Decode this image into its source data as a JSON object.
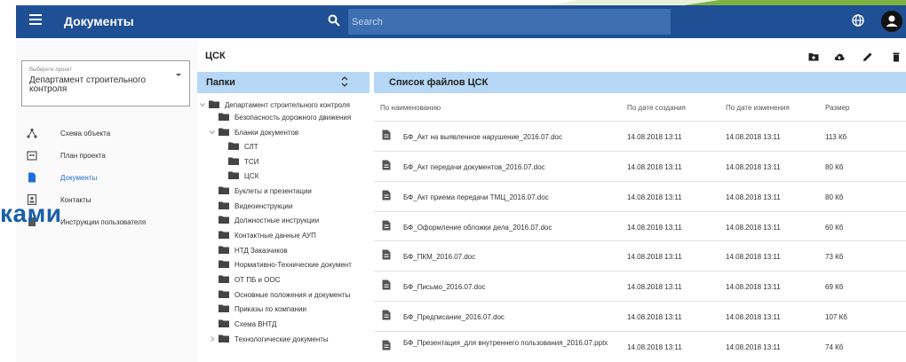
{
  "header": {
    "title": "Документы",
    "search_placeholder": "Search"
  },
  "project_select": {
    "caption": "Выберите проект",
    "value": "Департамент строительного контроля"
  },
  "nav": [
    {
      "label": "Схема объекта",
      "icon": "hierarchy-icon"
    },
    {
      "label": "План проекта",
      "icon": "calendar-icon"
    },
    {
      "label": "Документы",
      "icon": "document-icon",
      "active": true
    },
    {
      "label": "Контакты",
      "icon": "contacts-icon"
    },
    {
      "label": "Инструкции пользователя",
      "icon": "book-icon"
    }
  ],
  "overlay_text": "ками",
  "section_title": "ЦСК",
  "toolbar": [
    "new-folder-icon",
    "upload-cloud-icon",
    "edit-pencil-icon",
    "delete-trash-icon"
  ],
  "folders": {
    "title": "Папки",
    "items": [
      {
        "label": "Департамент строительного контроля",
        "level": 0,
        "chevron": "down"
      },
      {
        "label": "Безопасность дорожного движения",
        "level": 1
      },
      {
        "label": "Бланки документов",
        "level": 1,
        "chevron": "down"
      },
      {
        "label": "СЛТ",
        "level": 2
      },
      {
        "label": "ТСИ",
        "level": 2
      },
      {
        "label": "ЦСК",
        "level": 2
      },
      {
        "label": "Буклеты и презентации",
        "level": 1
      },
      {
        "label": "Видеоинструкции",
        "level": 1
      },
      {
        "label": "Должностные инструкции",
        "level": 1
      },
      {
        "label": "Контактные данные АУП",
        "level": 1
      },
      {
        "label": "НТД Заказчиков",
        "level": 1
      },
      {
        "label": "Нормативно-Технические документ",
        "level": 1
      },
      {
        "label": "ОТ ПБ и ООС",
        "level": 1
      },
      {
        "label": "Основные положения и документы",
        "level": 1
      },
      {
        "label": "Приказы по компании",
        "level": 1
      },
      {
        "label": "Схема ВНТД",
        "level": 1
      },
      {
        "label": "Технологические документы",
        "level": 1,
        "chevron": "right"
      }
    ]
  },
  "files": {
    "title": "Список файлов ЦСК",
    "columns": [
      "По наименованию",
      "По дате создания",
      "По дате изменения",
      "Размер"
    ],
    "rows": [
      {
        "name": "БФ_Акт на выявленное нарушение_2016.07.doc",
        "created": "14.08.2018 13:11",
        "modified": "14.08.2018 13:11",
        "size": "113 Кб"
      },
      {
        "name": "БФ_Акт передачи документов_2016.07.doc",
        "created": "14.08.2018 13:11",
        "modified": "14.08.2018 13:11",
        "size": "80 Кб"
      },
      {
        "name": "БФ_Акт приема передачи ТМЦ_2016.07.doc",
        "created": "14.08.2018 13:11",
        "modified": "14.08.2018 13:11",
        "size": "80 Кб"
      },
      {
        "name": "БФ_Оформление обложки дела_2016.07.doc",
        "created": "14.08.2018 13:11",
        "modified": "14.08.2018 13:11",
        "size": "60 Кб"
      },
      {
        "name": "БФ_ПКМ_2016.07.doc",
        "created": "14.08.2018 13:11",
        "modified": "14.08.2018 13:11",
        "size": "73 Кб"
      },
      {
        "name": "БФ_Письмо_2016.07.doc",
        "created": "14.08.2018 13:11",
        "modified": "14.08.2018 13:11",
        "size": "69 Кб"
      },
      {
        "name": "БФ_Предписание_2016.07.doc",
        "created": "14.08.2018 13:11",
        "modified": "14.08.2018 13:11",
        "size": "107 Кб"
      },
      {
        "name": "БФ_Презентация_для внутреннего пользования_2016.07.pptx",
        "created": "14.08.2018 13:11",
        "modified": "14.08.2018 13:11",
        "size": "74 Кб"
      }
    ]
  },
  "colors": {
    "header": "#1f4f94",
    "search": "#3d6fb1",
    "panel_head": "#b6d7f5",
    "active": "#1e6fd9",
    "deco_green": "#7cb342"
  }
}
